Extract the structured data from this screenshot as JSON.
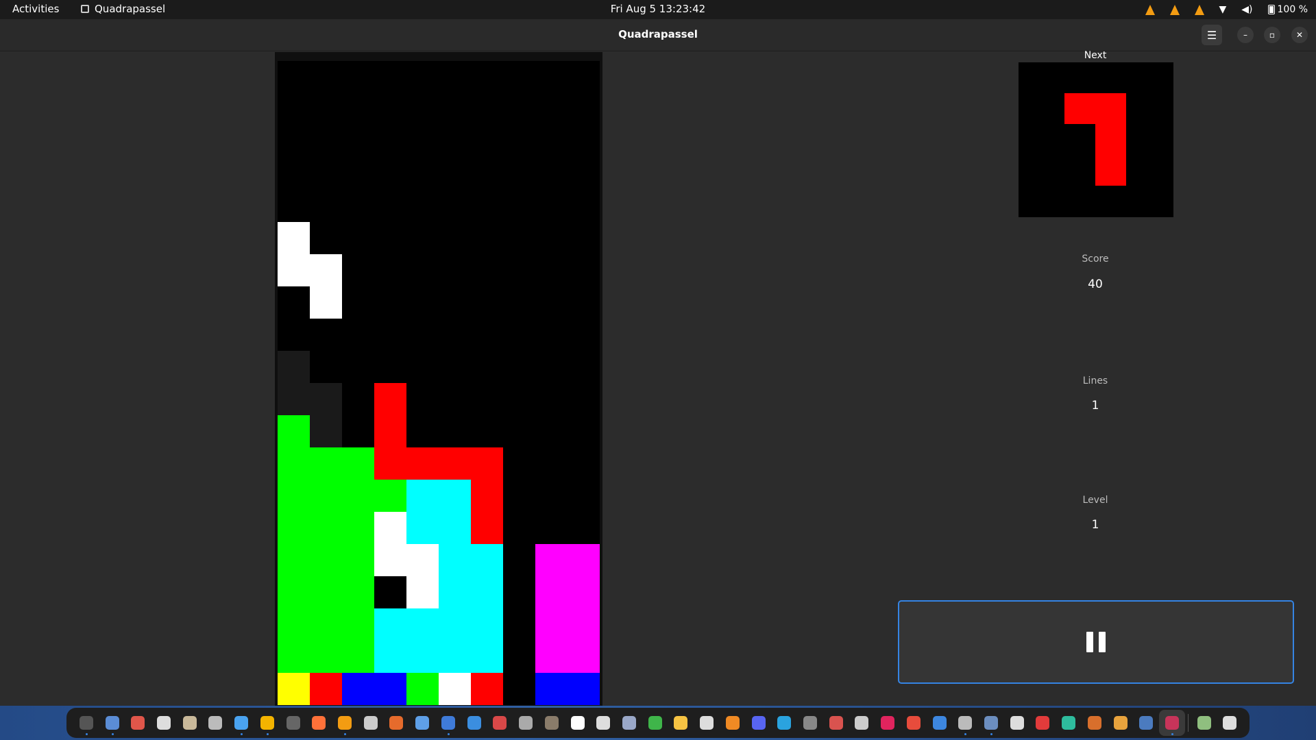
{
  "topbar": {
    "activities": "Activities",
    "app_name": "Quadrapassel",
    "clock": "Fri Aug 5  13:23:42",
    "battery": "100 %",
    "tray_icons": [
      "vlc-icon",
      "vlc-icon",
      "vlc-icon",
      "wifi-icon",
      "volume-icon",
      "battery-icon"
    ]
  },
  "window": {
    "title": "Quadrapassel",
    "menu_icon": "hamburger-menu-icon",
    "minimize_icon": "minimize-icon",
    "maximize_icon": "restore-icon",
    "close_icon": "close-icon"
  },
  "colors": {
    "white": "#ffffff",
    "red": "#ff0000",
    "green": "#00ff00",
    "cyan": "#00ffff",
    "magenta": "#ff00ff",
    "yellow": "#ffff00",
    "blue": "#0000ff",
    "ghost": "#1a1a1a",
    "accent": "#3584e4"
  },
  "board": {
    "columns": 10,
    "rows": 20,
    "falling_piece": "white",
    "cells": [
      {
        "row": 5,
        "col": 0,
        "color": "white"
      },
      {
        "row": 6,
        "col": 0,
        "color": "white"
      },
      {
        "row": 6,
        "col": 1,
        "color": "white"
      },
      {
        "row": 7,
        "col": 1,
        "color": "white"
      },
      {
        "row": 9,
        "col": 0,
        "color": "ghost"
      },
      {
        "row": 10,
        "col": 0,
        "color": "ghost"
      },
      {
        "row": 10,
        "col": 1,
        "color": "ghost"
      },
      {
        "row": 11,
        "col": 1,
        "color": "ghost"
      },
      {
        "row": 10,
        "col": 3,
        "color": "red"
      },
      {
        "row": 11,
        "col": 3,
        "color": "red"
      },
      {
        "row": 11,
        "col": 0,
        "color": "green"
      },
      {
        "row": 12,
        "col": 0,
        "color": "green"
      },
      {
        "row": 12,
        "col": 1,
        "color": "green"
      },
      {
        "row": 12,
        "col": 2,
        "color": "green"
      },
      {
        "row": 12,
        "col": 3,
        "color": "red"
      },
      {
        "row": 12,
        "col": 4,
        "color": "red"
      },
      {
        "row": 12,
        "col": 5,
        "color": "red"
      },
      {
        "row": 12,
        "col": 6,
        "color": "red"
      },
      {
        "row": 13,
        "col": 0,
        "color": "green"
      },
      {
        "row": 13,
        "col": 1,
        "color": "green"
      },
      {
        "row": 13,
        "col": 2,
        "color": "green"
      },
      {
        "row": 13,
        "col": 3,
        "color": "green"
      },
      {
        "row": 13,
        "col": 4,
        "color": "cyan"
      },
      {
        "row": 13,
        "col": 5,
        "color": "cyan"
      },
      {
        "row": 13,
        "col": 6,
        "color": "red"
      },
      {
        "row": 14,
        "col": 0,
        "color": "green"
      },
      {
        "row": 14,
        "col": 1,
        "color": "green"
      },
      {
        "row": 14,
        "col": 2,
        "color": "green"
      },
      {
        "row": 14,
        "col": 3,
        "color": "white"
      },
      {
        "row": 14,
        "col": 4,
        "color": "cyan"
      },
      {
        "row": 14,
        "col": 5,
        "color": "cyan"
      },
      {
        "row": 14,
        "col": 6,
        "color": "red"
      },
      {
        "row": 15,
        "col": 0,
        "color": "green"
      },
      {
        "row": 15,
        "col": 1,
        "color": "green"
      },
      {
        "row": 15,
        "col": 2,
        "color": "green"
      },
      {
        "row": 15,
        "col": 3,
        "color": "white"
      },
      {
        "row": 15,
        "col": 4,
        "color": "white"
      },
      {
        "row": 15,
        "col": 5,
        "color": "cyan"
      },
      {
        "row": 15,
        "col": 6,
        "color": "cyan"
      },
      {
        "row": 15,
        "col": 8,
        "color": "magenta"
      },
      {
        "row": 15,
        "col": 9,
        "color": "magenta"
      },
      {
        "row": 16,
        "col": 0,
        "color": "green"
      },
      {
        "row": 16,
        "col": 1,
        "color": "green"
      },
      {
        "row": 16,
        "col": 2,
        "color": "green"
      },
      {
        "row": 16,
        "col": 4,
        "color": "white"
      },
      {
        "row": 16,
        "col": 5,
        "color": "cyan"
      },
      {
        "row": 16,
        "col": 6,
        "color": "cyan"
      },
      {
        "row": 16,
        "col": 8,
        "color": "magenta"
      },
      {
        "row": 16,
        "col": 9,
        "color": "magenta"
      },
      {
        "row": 17,
        "col": 0,
        "color": "green"
      },
      {
        "row": 17,
        "col": 1,
        "color": "green"
      },
      {
        "row": 17,
        "col": 2,
        "color": "green"
      },
      {
        "row": 17,
        "col": 3,
        "color": "cyan"
      },
      {
        "row": 17,
        "col": 4,
        "color": "cyan"
      },
      {
        "row": 17,
        "col": 5,
        "color": "cyan"
      },
      {
        "row": 17,
        "col": 6,
        "color": "cyan"
      },
      {
        "row": 17,
        "col": 8,
        "color": "magenta"
      },
      {
        "row": 17,
        "col": 9,
        "color": "magenta"
      },
      {
        "row": 18,
        "col": 0,
        "color": "green"
      },
      {
        "row": 18,
        "col": 1,
        "color": "green"
      },
      {
        "row": 18,
        "col": 2,
        "color": "green"
      },
      {
        "row": 18,
        "col": 3,
        "color": "cyan"
      },
      {
        "row": 18,
        "col": 4,
        "color": "cyan"
      },
      {
        "row": 18,
        "col": 5,
        "color": "cyan"
      },
      {
        "row": 18,
        "col": 6,
        "color": "cyan"
      },
      {
        "row": 18,
        "col": 8,
        "color": "magenta"
      },
      {
        "row": 18,
        "col": 9,
        "color": "magenta"
      },
      {
        "row": 19,
        "col": 0,
        "color": "yellow"
      },
      {
        "row": 19,
        "col": 1,
        "color": "red"
      },
      {
        "row": 19,
        "col": 2,
        "color": "blue"
      },
      {
        "row": 19,
        "col": 3,
        "color": "blue"
      },
      {
        "row": 19,
        "col": 4,
        "color": "green"
      },
      {
        "row": 19,
        "col": 5,
        "color": "white"
      },
      {
        "row": 19,
        "col": 6,
        "color": "red"
      },
      {
        "row": 19,
        "col": 8,
        "color": "blue"
      },
      {
        "row": 19,
        "col": 9,
        "color": "blue"
      }
    ]
  },
  "next": {
    "label": "Next",
    "piece": "red",
    "cells": [
      {
        "row": 0,
        "col": 0
      },
      {
        "row": 0,
        "col": 1
      },
      {
        "row": 1,
        "col": 1
      },
      {
        "row": 2,
        "col": 1
      }
    ]
  },
  "stats": {
    "score_label": "Score",
    "score": "40",
    "lines_label": "Lines",
    "lines": "1",
    "level_label": "Level",
    "level": "1"
  },
  "pause_button": {
    "icon": "pause-icon"
  },
  "dock": {
    "apps": [
      {
        "name": "terminal-app-icon",
        "color": "#555555",
        "running": true
      },
      {
        "name": "files-app-icon",
        "color": "#5b8dd6",
        "running": true
      },
      {
        "name": "chrome-app-icon",
        "color": "#e0564a",
        "running": false
      },
      {
        "name": "document-viewer-app-icon",
        "color": "#dddddd",
        "running": false
      },
      {
        "name": "archive-app-icon",
        "color": "#c9b99a",
        "running": false
      },
      {
        "name": "screenshot-app-icon",
        "color": "#bbbbbb",
        "running": false
      },
      {
        "name": "text-editor-app-icon",
        "color": "#4aa3f0",
        "running": true
      },
      {
        "name": "calculator-app-icon",
        "color": "#f4b400",
        "running": true
      },
      {
        "name": "console-app-icon",
        "color": "#666666",
        "running": false
      },
      {
        "name": "firefox-app-icon",
        "color": "#ff7139",
        "running": false
      },
      {
        "name": "vlc-app-icon",
        "color": "#f39c12",
        "running": true
      },
      {
        "name": "obs-app-icon",
        "color": "#cccccc",
        "running": false
      },
      {
        "name": "software-store-app-icon",
        "color": "#e66b2c",
        "running": false
      },
      {
        "name": "writer-app-icon",
        "color": "#5fa0e8",
        "running": false
      },
      {
        "name": "docs-app-icon",
        "color": "#3f7bd9",
        "running": true
      },
      {
        "name": "help-app-icon",
        "color": "#3b8ee0",
        "running": false
      },
      {
        "name": "system-monitor-app-icon",
        "color": "#d94848",
        "running": false
      },
      {
        "name": "camera-app-icon",
        "color": "#aaaaaa",
        "running": false
      },
      {
        "name": "gimp-app-icon",
        "color": "#8a7c6a",
        "running": false
      },
      {
        "name": "inkscape-app-icon",
        "color": "#ffffff",
        "running": false
      },
      {
        "name": "cube-app-icon",
        "color": "#dddddd",
        "running": false
      },
      {
        "name": "recorder-app-icon",
        "color": "#9aa8c8",
        "running": false
      },
      {
        "name": "spreadsheet-app-icon",
        "color": "#3fb54a",
        "running": false
      },
      {
        "name": "notes-app-icon",
        "color": "#f6c343",
        "running": false
      },
      {
        "name": "music-app-icon",
        "color": "#dddddd",
        "running": false
      },
      {
        "name": "calendar-app-icon",
        "color": "#f08a24",
        "running": false
      },
      {
        "name": "discord-app-icon",
        "color": "#5865f2",
        "running": false
      },
      {
        "name": "telegram-app-icon",
        "color": "#2aa3df",
        "running": false
      },
      {
        "name": "disk-app-icon",
        "color": "#888888",
        "running": false
      },
      {
        "name": "pdf-app-icon",
        "color": "#d9534f",
        "running": false
      },
      {
        "name": "percent-app-icon",
        "color": "#cccccc",
        "running": false
      },
      {
        "name": "video-app-icon",
        "color": "#e0245e",
        "running": false
      },
      {
        "name": "mahjongg-app-icon",
        "color": "#e74c3c",
        "running": false
      },
      {
        "name": "impress-app-icon",
        "color": "#3d87e0",
        "running": false
      },
      {
        "name": "backup-app-icon",
        "color": "#bbbbbb",
        "running": true
      },
      {
        "name": "settings-app-icon",
        "color": "#6c8ebf",
        "running": true
      },
      {
        "name": "clock-app-icon",
        "color": "#dddddd",
        "running": false
      },
      {
        "name": "solitaire-app-icon",
        "color": "#e23b3b",
        "running": false
      },
      {
        "name": "map-app-icon",
        "color": "#2ebc9d",
        "running": false
      },
      {
        "name": "robots-app-icon",
        "color": "#d86f2c",
        "running": false
      },
      {
        "name": "chat-app-icon",
        "color": "#e8a33d",
        "running": false
      },
      {
        "name": "remote-app-icon",
        "color": "#4b7bbf",
        "running": false
      },
      {
        "name": "quadrapassel-app-icon",
        "color": "#c7345a",
        "running": true,
        "active": true
      }
    ],
    "trailing": [
      {
        "name": "trash-app-icon",
        "color": "#8fbf7f"
      },
      {
        "name": "show-apps-icon",
        "color": "#dddddd"
      }
    ]
  }
}
